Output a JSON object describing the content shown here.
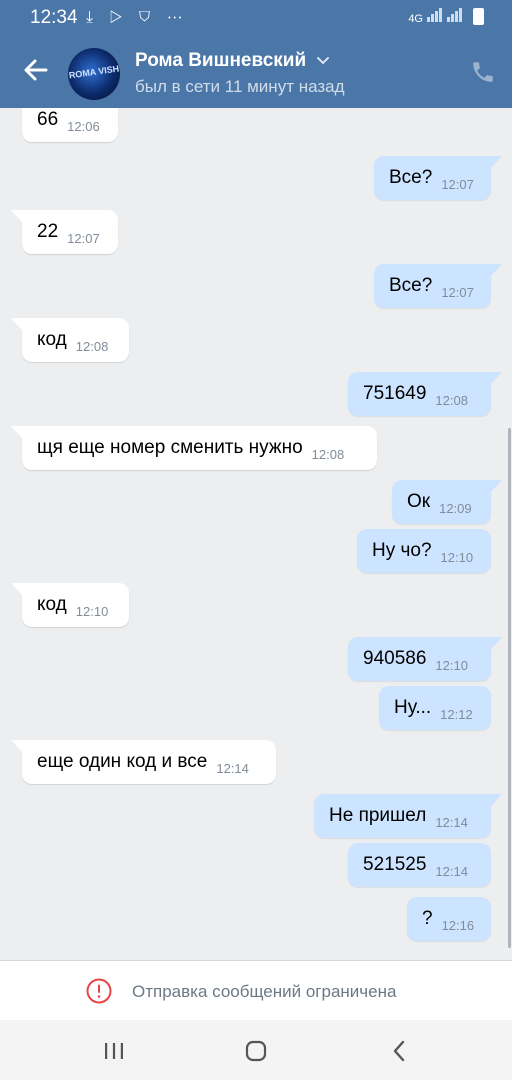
{
  "status_bar": {
    "time": "12:34",
    "network": "4G"
  },
  "header": {
    "contact_name": "Рома Вишневский",
    "last_seen": "был в сети 11 минут назад",
    "avatar_text": "ROMA VISH",
    "accent_color": "#4a76a8"
  },
  "messages": [
    {
      "dir": "in",
      "text": "66",
      "time": "12:06"
    },
    {
      "dir": "out",
      "text": "Все?",
      "time": "12:07"
    },
    {
      "dir": "in",
      "text": "22",
      "time": "12:07"
    },
    {
      "dir": "out",
      "text": "Все?",
      "time": "12:07"
    },
    {
      "dir": "in",
      "text": "код",
      "time": "12:08"
    },
    {
      "dir": "out",
      "text": "751649",
      "time": "12:08"
    },
    {
      "dir": "in",
      "text": "щя еще номер сменить нужно",
      "time": "12:08"
    },
    {
      "dir": "out",
      "text": "Ок",
      "time": "12:09"
    },
    {
      "dir": "out",
      "text": "Ну чо?",
      "time": "12:10"
    },
    {
      "dir": "in",
      "text": "код",
      "time": "12:10"
    },
    {
      "dir": "out",
      "text": "940586",
      "time": "12:10"
    },
    {
      "dir": "out",
      "text": "Ну...",
      "time": "12:12"
    },
    {
      "dir": "in",
      "text": "еще один код и все",
      "time": "12:14"
    },
    {
      "dir": "out",
      "text": "Не пришел",
      "time": "12:14"
    },
    {
      "dir": "out",
      "text": "521525",
      "time": "12:14"
    },
    {
      "dir": "out",
      "text": "?",
      "time": "12:16"
    }
  ],
  "restriction": {
    "text": "Отправка сообщений ограничена",
    "icon": "warning-icon",
    "color": "#e64646"
  },
  "colors": {
    "incoming_bubble": "#ffffff",
    "outgoing_bubble": "#cce4ff",
    "background": "#edeef0"
  }
}
